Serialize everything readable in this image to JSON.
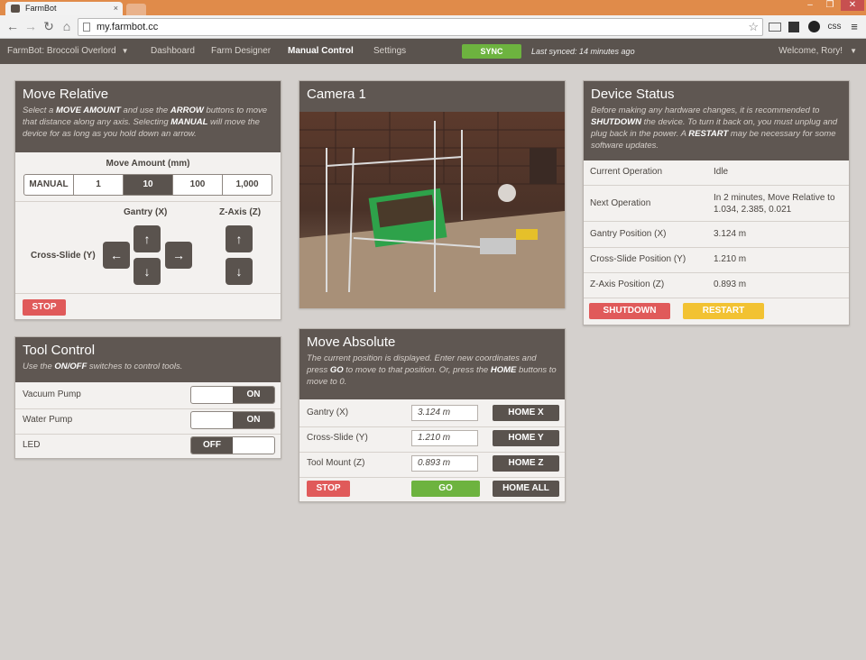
{
  "browser": {
    "tab_title": "FarmBot",
    "tab_close": "×",
    "url": "my.farmbot.cc",
    "css_ext": "css",
    "win_min": "–",
    "win_max": "❐",
    "win_close": "✕"
  },
  "appnav": {
    "brand": "FarmBot: Broccoli Overlord",
    "items": [
      "Dashboard",
      "Farm Designer",
      "Manual Control",
      "Settings"
    ],
    "active": "Manual Control",
    "sync_label": "SYNC",
    "last_synced": "Last synced: 14 minutes ago",
    "welcome": "Welcome, Rory!"
  },
  "move_relative": {
    "title": "Move Relative",
    "desc_parts": [
      "Select a ",
      "MOVE AMOUNT",
      " and use the ",
      "ARROW",
      " buttons to move that distance along any axis. Selecting ",
      "MANUAL",
      " will move the device for as long as you hold down an arrow."
    ],
    "amount_label": "Move Amount (mm)",
    "amounts": [
      "MANUAL",
      "1",
      "10",
      "100",
      "1,000"
    ],
    "selected_amount": "10",
    "gantry_label": "Gantry (X)",
    "zaxis_label": "Z-Axis (Z)",
    "crossslide_label": "Cross-Slide (Y)",
    "stop_label": "STOP"
  },
  "tool_control": {
    "title": "Tool Control",
    "desc_parts": [
      "Use the ",
      "ON/OFF",
      " switches to control tools."
    ],
    "tools": [
      {
        "name": "Vacuum Pump",
        "state": "ON"
      },
      {
        "name": "Water Pump",
        "state": "ON"
      },
      {
        "name": "LED",
        "state": "OFF"
      }
    ]
  },
  "camera": {
    "title": "Camera 1"
  },
  "move_absolute": {
    "title": "Move Absolute",
    "desc_parts": [
      "The current position is displayed. Enter new coordinates and press ",
      "GO",
      " to move to that position. Or, press the ",
      "HOME",
      " buttons to move to 0."
    ],
    "axes": [
      {
        "label": "Gantry (X)",
        "value": "3.124 m",
        "home": "HOME X"
      },
      {
        "label": "Cross-Slide (Y)",
        "value": "1.210 m",
        "home": "HOME Y"
      },
      {
        "label": "Tool Mount (Z)",
        "value": "0.893 m",
        "home": "HOME Z"
      }
    ],
    "stop_label": "STOP",
    "go_label": "GO",
    "home_all_label": "HOME ALL"
  },
  "device_status": {
    "title": "Device Status",
    "desc_parts": [
      "Before making any hardware changes, it is recommended to ",
      "SHUTDOWN",
      " the device. To turn it back on, you must unplug and plug back in the power. A ",
      "RESTART",
      " may be necessary for some software updates."
    ],
    "rows": [
      {
        "label": "Current Operation",
        "value": "Idle"
      },
      {
        "label": "Next Operation",
        "value": "In 2 minutes, Move Relative to 1.034, 2.385, 0.021"
      },
      {
        "label": "Gantry Position (X)",
        "value": "3.124 m"
      },
      {
        "label": "Cross-Slide Position (Y)",
        "value": "1.210 m"
      },
      {
        "label": "Z-Axis Position (Z)",
        "value": "0.893 m"
      }
    ],
    "shutdown_label": "SHUTDOWN",
    "restart_label": "RESTART"
  },
  "colors": {
    "header_bg": "#5f5752",
    "nav_bg": "#5a534e",
    "green": "#6db33f",
    "red": "#e05a5a",
    "yellow": "#f2c232",
    "page_bg": "#d4d0cd"
  }
}
